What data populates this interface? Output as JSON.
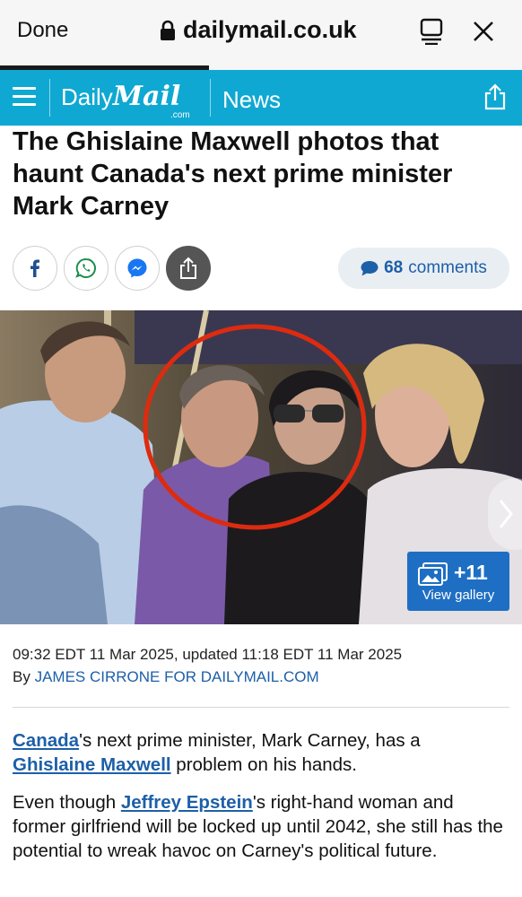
{
  "browser": {
    "done_label": "Done",
    "url": "dailymail.co.uk"
  },
  "site": {
    "logo_daily": "Daily",
    "logo_mail": "Mail",
    "logo_com": ".com",
    "section": "News",
    "accent_color": "#0fa8d2"
  },
  "article": {
    "headline": "The Ghislaine Maxwell photos that haunt Canada's next prime minister Mark Carney",
    "comments_count": "68",
    "comments_label": "comments",
    "gallery_count": "+11",
    "gallery_label": "View gallery",
    "dateline": "09:32 EDT 11 Mar 2025, updated 11:18 EDT 11 Mar 2025",
    "by_prefix": "By",
    "author": "JAMES CIRRONE FOR DAILYMAIL.COM",
    "p1_link1": "Canada",
    "p1_text1": "'s next prime minister, Mark Carney, has a",
    "p1_link2": "Ghislaine Maxwell",
    "p1_text2": " problem on his hands.",
    "p2_text1": "Even though ",
    "p2_link1": "Jeffrey Epstein",
    "p2_text2": "'s right-hand woman and former girlfriend will be locked up until 2042, she still has the potential to wreak havoc on Carney's political future."
  },
  "social": {
    "icons": [
      "facebook-icon",
      "whatsapp-icon",
      "messenger-icon",
      "share-icon"
    ]
  }
}
